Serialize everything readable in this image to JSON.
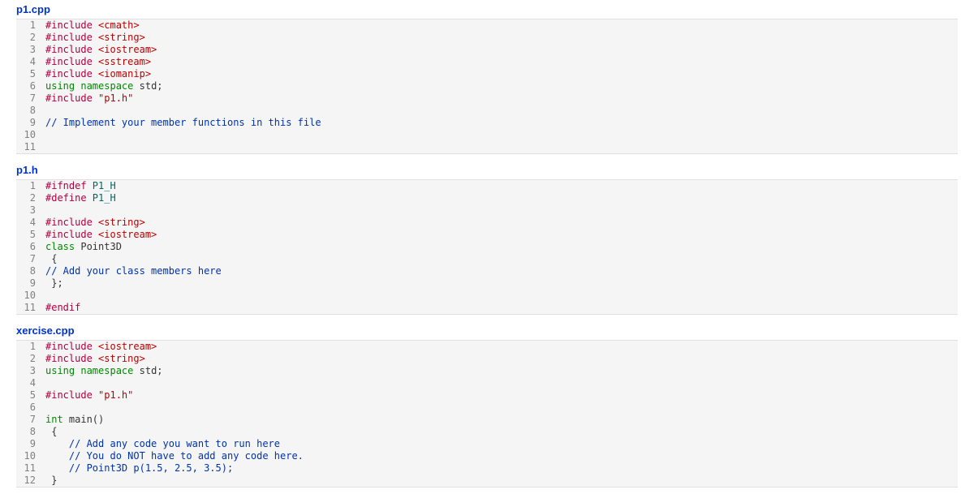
{
  "files": [
    {
      "name": "p1.cpp",
      "lines": [
        {
          "n": 1,
          "t": [
            {
              "c": "pre",
              "s": "#include "
            },
            {
              "c": "hdr",
              "s": "<cmath>"
            }
          ]
        },
        {
          "n": 2,
          "t": [
            {
              "c": "pre",
              "s": "#include "
            },
            {
              "c": "hdr",
              "s": "<string>"
            }
          ]
        },
        {
          "n": 3,
          "t": [
            {
              "c": "pre",
              "s": "#include "
            },
            {
              "c": "hdr",
              "s": "<iostream>"
            }
          ]
        },
        {
          "n": 4,
          "t": [
            {
              "c": "pre",
              "s": "#include "
            },
            {
              "c": "hdr",
              "s": "<sstream>"
            }
          ]
        },
        {
          "n": 5,
          "t": [
            {
              "c": "pre",
              "s": "#include "
            },
            {
              "c": "hdr",
              "s": "<iomanip>"
            }
          ]
        },
        {
          "n": 6,
          "t": [
            {
              "c": "kw",
              "s": "using "
            },
            {
              "c": "kw",
              "s": "namespace"
            },
            {
              "c": "plain",
              "s": " std;"
            }
          ]
        },
        {
          "n": 7,
          "t": [
            {
              "c": "pre",
              "s": "#include "
            },
            {
              "c": "str",
              "s": "\"p1.h\""
            }
          ]
        },
        {
          "n": 8,
          "t": []
        },
        {
          "n": 9,
          "t": [
            {
              "c": "cmt",
              "s": "// Implement your member functions in this file"
            }
          ]
        },
        {
          "n": 10,
          "t": []
        },
        {
          "n": 11,
          "t": []
        }
      ]
    },
    {
      "name": "p1.h",
      "lines": [
        {
          "n": 1,
          "t": [
            {
              "c": "pre",
              "s": "#ifndef "
            },
            {
              "c": "mac",
              "s": "P1_H"
            }
          ]
        },
        {
          "n": 2,
          "t": [
            {
              "c": "pre",
              "s": "#define "
            },
            {
              "c": "mac",
              "s": "P1_H"
            }
          ]
        },
        {
          "n": 3,
          "t": []
        },
        {
          "n": 4,
          "t": [
            {
              "c": "pre",
              "s": "#include "
            },
            {
              "c": "hdr",
              "s": "<string>"
            }
          ]
        },
        {
          "n": 5,
          "t": [
            {
              "c": "pre",
              "s": "#include "
            },
            {
              "c": "hdr",
              "s": "<iostream>"
            }
          ]
        },
        {
          "n": 6,
          "t": [
            {
              "c": "kw",
              "s": "class"
            },
            {
              "c": "plain",
              "s": " Point3D"
            }
          ]
        },
        {
          "n": 7,
          "t": [
            {
              "c": "plain",
              "s": " {"
            }
          ]
        },
        {
          "n": 8,
          "t": [
            {
              "c": "cmt",
              "s": "// Add your class members here"
            }
          ]
        },
        {
          "n": 9,
          "t": [
            {
              "c": "plain",
              "s": " };"
            }
          ]
        },
        {
          "n": 10,
          "t": []
        },
        {
          "n": 11,
          "t": [
            {
              "c": "pre",
              "s": "#endif"
            }
          ]
        }
      ]
    },
    {
      "name": "xercise.cpp",
      "lines": [
        {
          "n": 1,
          "t": [
            {
              "c": "pre",
              "s": "#include "
            },
            {
              "c": "hdr",
              "s": "<iostream>"
            }
          ]
        },
        {
          "n": 2,
          "t": [
            {
              "c": "pre",
              "s": "#include "
            },
            {
              "c": "hdr",
              "s": "<string>"
            }
          ]
        },
        {
          "n": 3,
          "t": [
            {
              "c": "kw",
              "s": "using "
            },
            {
              "c": "kw",
              "s": "namespace"
            },
            {
              "c": "plain",
              "s": " std;"
            }
          ]
        },
        {
          "n": 4,
          "t": []
        },
        {
          "n": 5,
          "t": [
            {
              "c": "pre",
              "s": "#include "
            },
            {
              "c": "str",
              "s": "\"p1.h\""
            }
          ]
        },
        {
          "n": 6,
          "t": []
        },
        {
          "n": 7,
          "t": [
            {
              "c": "typ",
              "s": "int"
            },
            {
              "c": "plain",
              "s": " main()"
            }
          ]
        },
        {
          "n": 8,
          "t": [
            {
              "c": "plain",
              "s": " {"
            }
          ]
        },
        {
          "n": 9,
          "t": [
            {
              "c": "plain",
              "s": "    "
            },
            {
              "c": "cmt",
              "s": "// Add any code you want to run here"
            }
          ]
        },
        {
          "n": 10,
          "t": [
            {
              "c": "plain",
              "s": "    "
            },
            {
              "c": "cmt",
              "s": "// You do NOT have to add any code here."
            }
          ]
        },
        {
          "n": 11,
          "t": [
            {
              "c": "plain",
              "s": "    "
            },
            {
              "c": "cmt",
              "s": "// Point3D p(1.5, 2.5, 3.5);"
            }
          ]
        },
        {
          "n": 12,
          "t": [
            {
              "c": "plain",
              "s": " }"
            }
          ]
        }
      ]
    }
  ]
}
